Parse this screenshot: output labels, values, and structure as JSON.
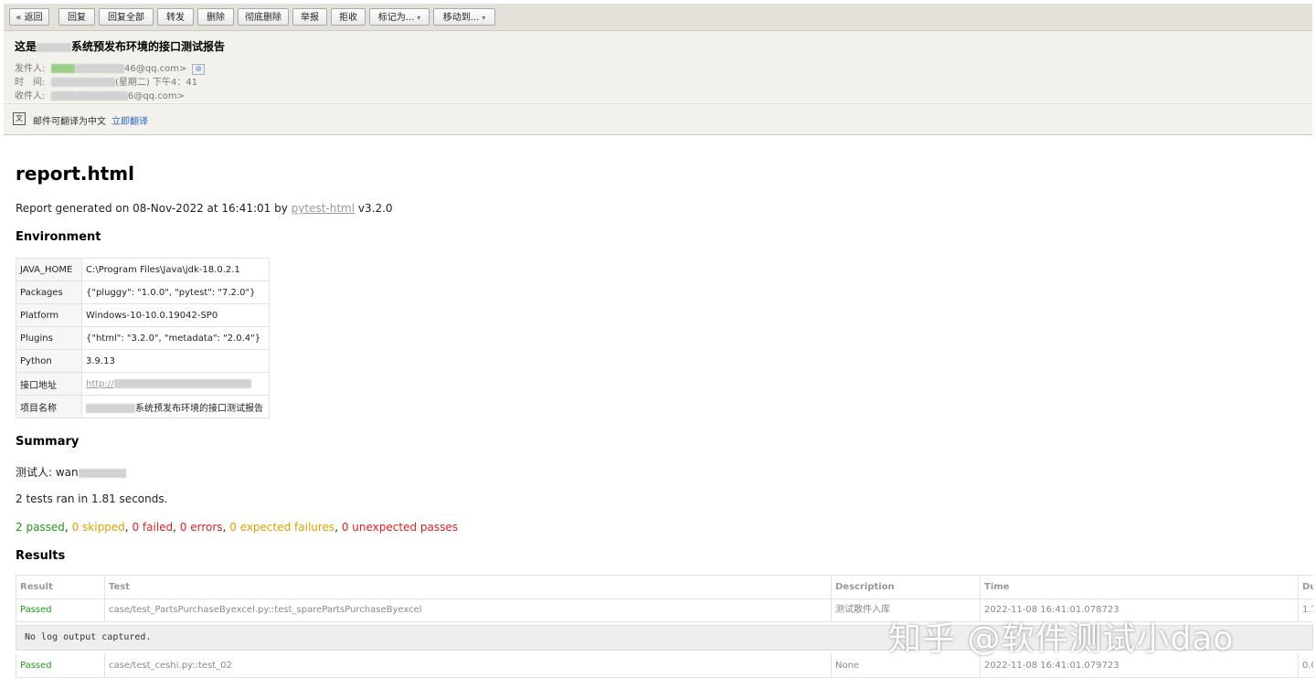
{
  "toolbar": {
    "back": "« 返回",
    "reply": "回复",
    "reply_all": "回复全部",
    "forward": "转发",
    "delete": "删除",
    "delete_permanently": "彻底删除",
    "report_spam": "举报",
    "reject": "拒收",
    "mark_as": "标记为...",
    "move_to": "移动到..."
  },
  "mail": {
    "subject_prefix": "这是",
    "subject_suffix": "系统预发布环境的接口测试报告",
    "from_label": "发件人:",
    "from_value": "46@qq.com>",
    "time_label": "时　间:",
    "time_value": "(星期二) 下午4：41",
    "to_label": "收件人:",
    "to_value": "6@qq.com>"
  },
  "translate": {
    "notice": "邮件可翻译为中文",
    "action": "立即翻译"
  },
  "report": {
    "title": "report.html",
    "generated_prefix": "Report generated on 08-Nov-2022 at 16:41:01 by ",
    "generator_link": "pytest-html",
    "generated_suffix": " v3.2.0",
    "environment_heading": "Environment",
    "environment": [
      {
        "key": "JAVA_HOME",
        "value": "C:\\Program Files\\Java\\jdk-18.0.2.1"
      },
      {
        "key": "Packages",
        "value": "{\"pluggy\": \"1.0.0\", \"pytest\": \"7.2.0\"}"
      },
      {
        "key": "Platform",
        "value": "Windows-10-10.0.19042-SP0"
      },
      {
        "key": "Plugins",
        "value": "{\"html\": \"3.2.0\", \"metadata\": \"2.0.4\"}"
      },
      {
        "key": "Python",
        "value": "3.9.13"
      },
      {
        "key": "接口地址",
        "value": "http://"
      },
      {
        "key": "项目名称",
        "value": "系统预发布环境的接口测试报告"
      }
    ],
    "summary_heading": "Summary",
    "tester": "测试人: wan",
    "tests_ran": "2 tests ran in 1.81 seconds.",
    "counts": {
      "passed": "2 passed",
      "skipped": "0 skipped",
      "failed": "0 failed",
      "errors": "0 errors",
      "expected_failures": "0 expected failures",
      "unexpected_passes": "0 unexpected passes"
    },
    "results_heading": "Results",
    "results_columns": [
      "Result",
      "Test",
      "Description",
      "Time",
      "Du"
    ],
    "results": [
      {
        "result": "Passed",
        "test": "case/test_PartsPurchaseByexcel.py::test_sparePartsPurchaseByexcel",
        "description": "测试散件入库",
        "time": "2022-11-08 16:41:01.078723",
        "duration": "1.7"
      },
      {
        "result": "Passed",
        "test": "case/test_ceshi.py::test_02",
        "description": "None",
        "time": "2022-11-08 16:41:01.079723",
        "duration": "0.0"
      }
    ],
    "log_output": "No log output captured."
  },
  "watermark": "知乎 @软件测试小dao"
}
